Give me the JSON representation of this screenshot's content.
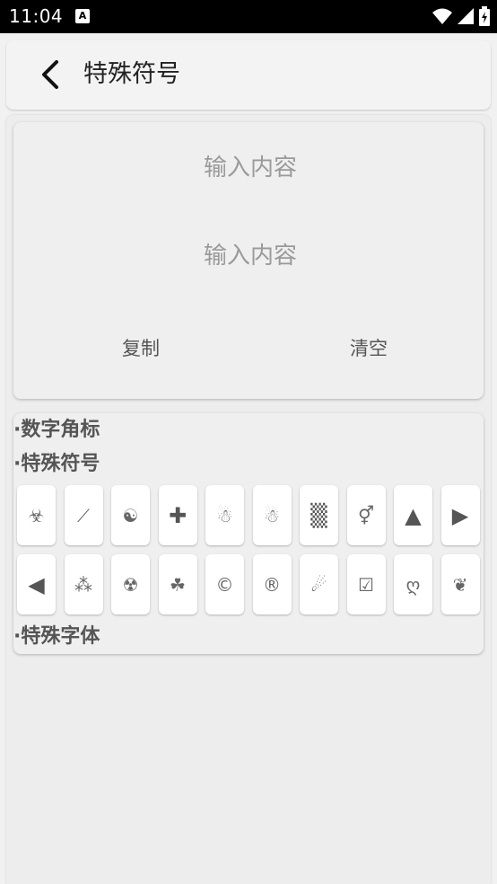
{
  "status_bar": {
    "time": "11:04",
    "notif_label": "A"
  },
  "header": {
    "title": "特殊符号"
  },
  "input": {
    "placeholder_1": "输入内容",
    "placeholder_2": "输入内容"
  },
  "actions": {
    "copy": "复制",
    "clear": "清空"
  },
  "sections": {
    "number_badge": "·数字角标",
    "special_symbols": "·特殊符号",
    "special_fonts": "·特殊字体"
  },
  "symbols": [
    "☣",
    "⟋",
    "☯",
    "✚",
    "☃",
    "☃",
    "▒",
    "⚥",
    "▲",
    "▶",
    "◀",
    "⁂",
    "☢",
    "☘",
    "©",
    "®",
    "☄",
    "☑",
    "ღ",
    "❦"
  ]
}
